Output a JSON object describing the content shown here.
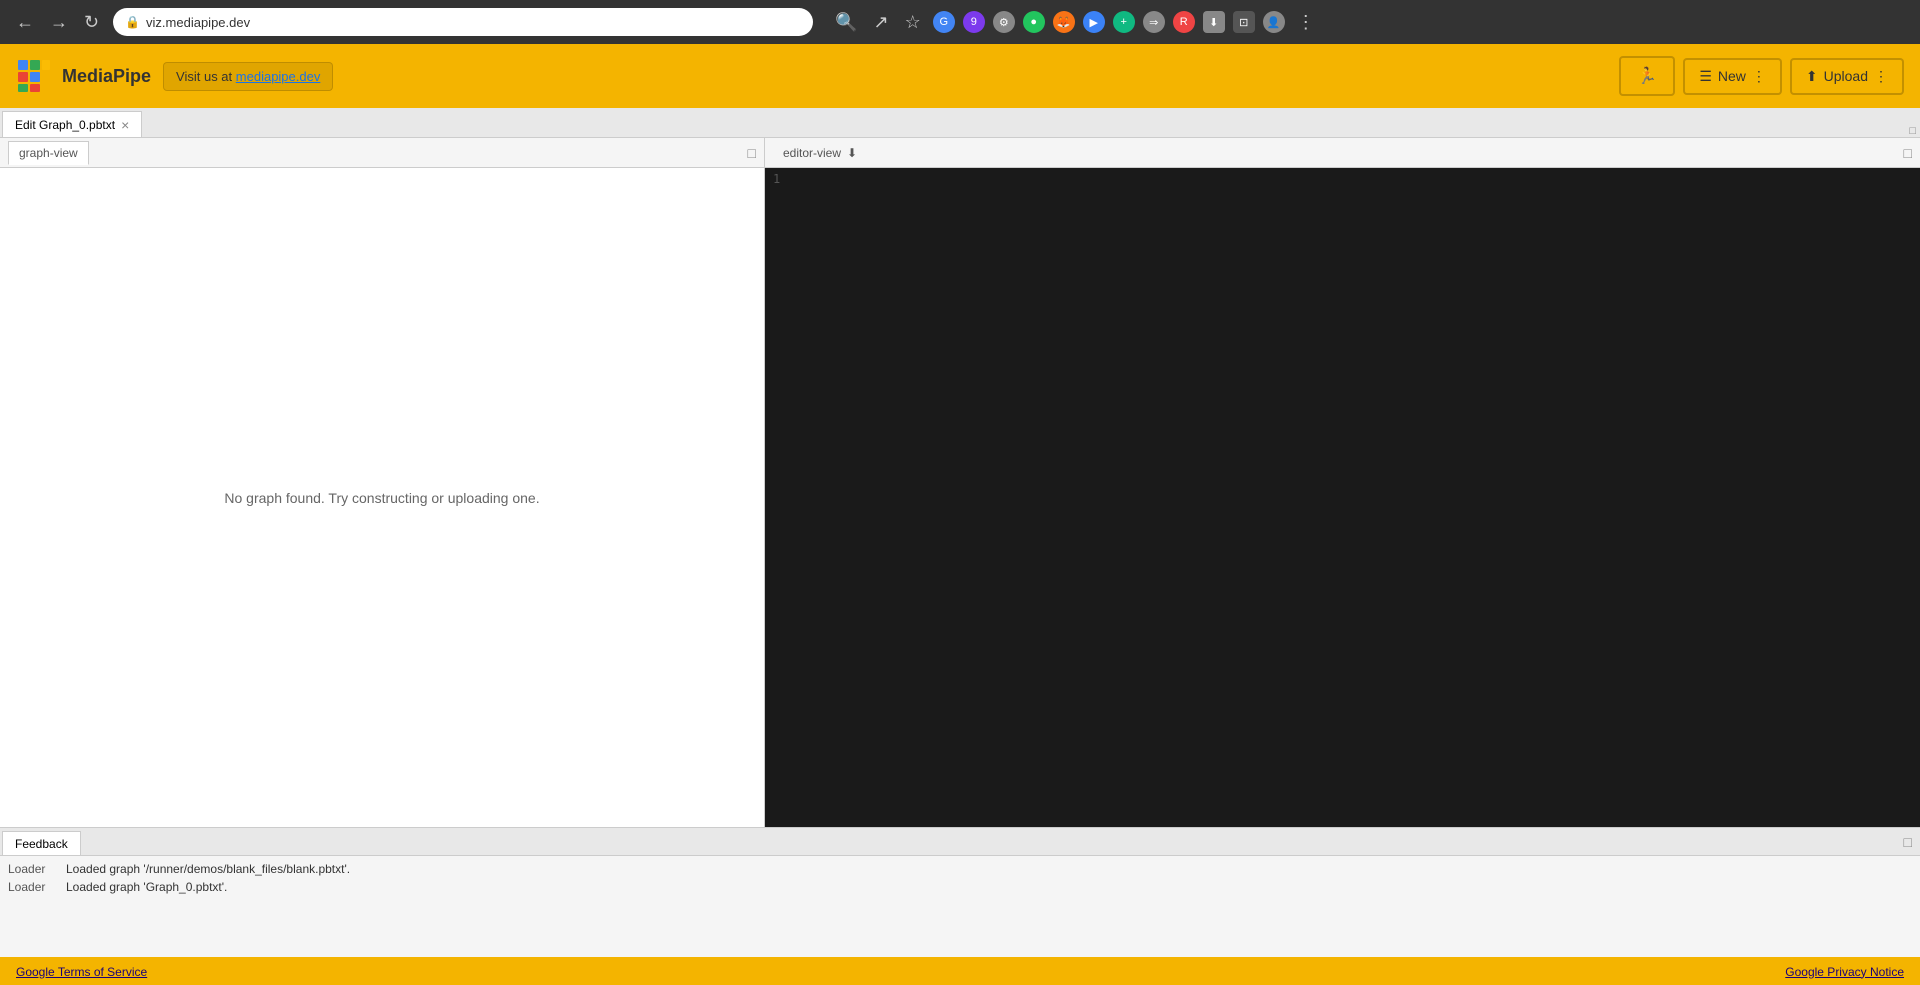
{
  "browser": {
    "url": "viz.mediapipe.dev",
    "back_tooltip": "Back",
    "forward_tooltip": "Forward",
    "reload_tooltip": "Reload"
  },
  "header": {
    "app_name": "MediaPipe",
    "visit_label": "Visit us at",
    "visit_link_text": "mediapipe.dev",
    "run_icon": "▶",
    "new_label": "New",
    "upload_label": "Upload",
    "new_menu_icon": "⋮",
    "upload_menu_icon": "⋮"
  },
  "tab_bar": {
    "tab_label": "Edit Graph_0.pbtxt",
    "close_icon": "×",
    "maximize_icon": "□"
  },
  "left_panel": {
    "tab_label": "graph-view",
    "maximize_icon": "□",
    "empty_message": "No graph found. Try constructing or uploading one."
  },
  "right_panel": {
    "tab_label": "editor-view",
    "download_icon": "⬇",
    "maximize_icon": "□",
    "line_number": "1"
  },
  "feedback_panel": {
    "tab_label": "Feedback",
    "maximize_icon": "□",
    "rows": [
      {
        "label": "Loader",
        "message": "Loaded graph '/runner/demos/blank_files/blank.pbtxt'."
      },
      {
        "label": "Loader",
        "message": "Loaded graph 'Graph_0.pbtxt'."
      }
    ]
  },
  "footer": {
    "terms_label": "Google Terms of Service",
    "privacy_label": "Google Privacy Notice"
  }
}
